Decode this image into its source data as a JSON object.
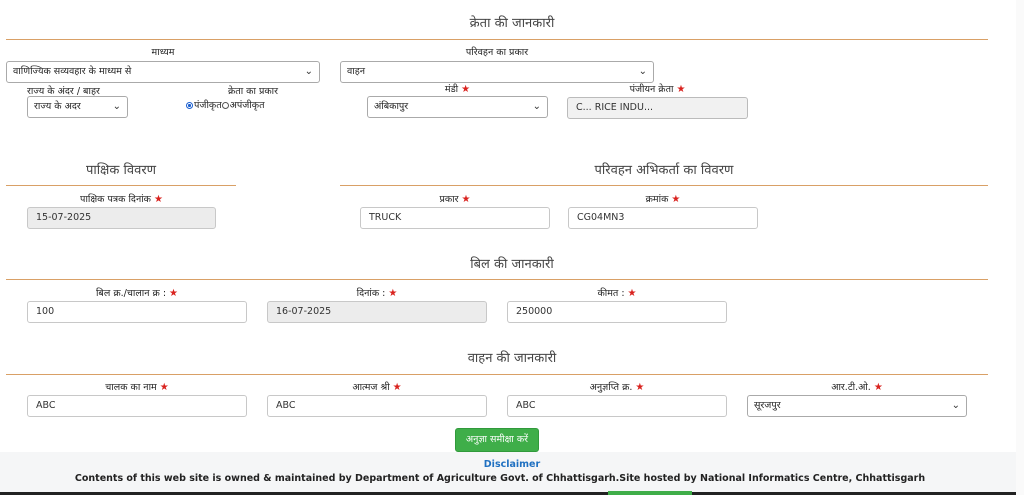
{
  "buyer_section": {
    "heading": "क्रेता की जानकारी",
    "medium_label": "माध्यम",
    "medium_value": "वाणिज्यिक सव्यवहार के माध्यम से",
    "transport_type_label": "परिवहन का प्रकार",
    "transport_type_value": "वाहन",
    "state_label": "राज्य के अंदर / बाहर",
    "state_value": "राज्य के अदर",
    "buyer_type_label": "क्रेता का प्रकार",
    "buyer_type_options": [
      "पंजीकृत",
      "अपंजीकृत"
    ],
    "mandi_label": "मंडी",
    "mandi_value": "अंबिकापुर",
    "registered_buyer_label": "पंजीयन क्रेता",
    "registered_buyer_value": "C... RICE INDU..."
  },
  "fortnight_section": {
    "heading": "पाक्षिक विवरण",
    "date_label": "पाक्षिक पत्रक दिनांक",
    "date_value": "15-07-2025"
  },
  "agent_section": {
    "heading": "परिवहन अभिकर्ता का विवरण",
    "type_label": "प्रकार",
    "type_value": "TRUCK",
    "number_label": "क्रमांक",
    "number_value": "CG04MN3"
  },
  "bill_section": {
    "heading": "बिल की जानकारी",
    "bill_no_label": "बिल क्र./चालान क्र :",
    "bill_no_value": "100",
    "date_label": "दिनांक :",
    "date_value": "16-07-2025",
    "price_label": "कीमत :",
    "price_value": "250000"
  },
  "vehicle_section": {
    "heading": "वाहन की जानकारी",
    "driver_label": "चालक का नाम",
    "driver_value": "ABC",
    "father_label": "आत्मज श्री",
    "father_value": "ABC",
    "license_label": "अनुज्ञप्ति क्र.",
    "license_value": "ABC",
    "rto_label": "आर.टी.ओ.",
    "rto_value": "सूरजपुर"
  },
  "review_button": "अनुज्ञा समीक्षा करें",
  "footer": {
    "disclaimer": "Disclaimer",
    "text": "Contents of this web site is owned & maintained by Department of Agriculture Govt. of Chhattisgarh.Site hosted by National Informatics Centre, Chhattisgarh"
  },
  "colors": {
    "rule": "#d9a066",
    "required_star": "#d9231f",
    "button_green": "#3fae49",
    "link_blue": "#1f70c1"
  }
}
